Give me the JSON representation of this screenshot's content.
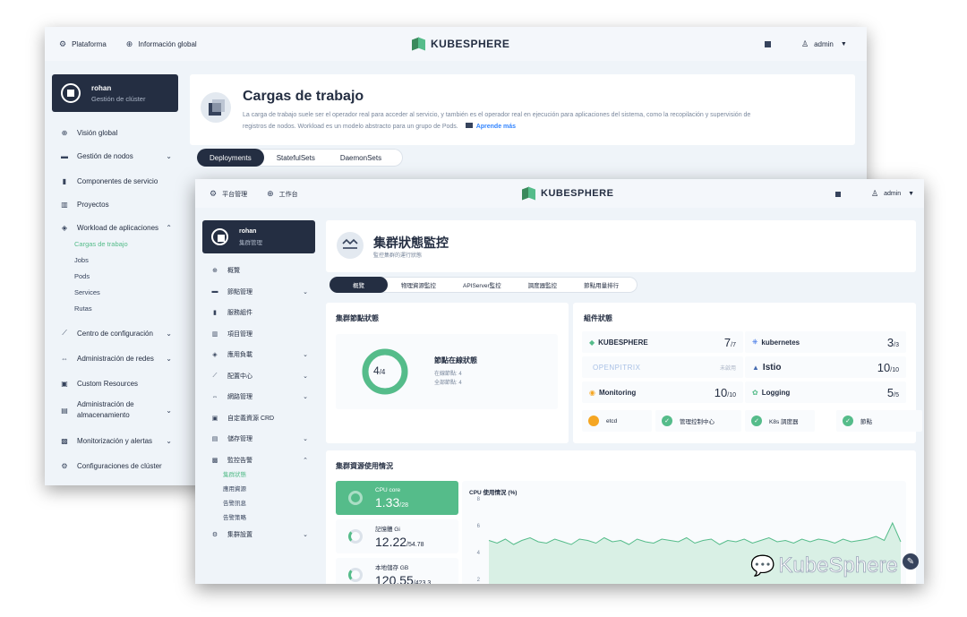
{
  "back": {
    "topbar": {
      "platform": "Plataforma",
      "global_info": "Información global",
      "logo": "KUBESPHERE",
      "user": "admin"
    },
    "cluster": {
      "name": "rohan",
      "role": "Gestión de clúster"
    },
    "nav": [
      {
        "label": "Visión global",
        "icon": "globe-icon",
        "chevron": false
      },
      {
        "label": "Gestión de nodos",
        "icon": "server-icon",
        "chevron": true
      },
      {
        "label": "Componentes de servicio",
        "icon": "components-icon",
        "chevron": false
      },
      {
        "label": "Proyectos",
        "icon": "projects-icon",
        "chevron": false
      },
      {
        "label": "Workload de aplicaciones",
        "icon": "layers-icon",
        "chevron": true,
        "expanded": true
      }
    ],
    "nav_sub": [
      "Cargas de trabajo",
      "Jobs",
      "Pods",
      "Services",
      "Rutas"
    ],
    "nav_more": [
      {
        "label": "Centro de configuración",
        "icon": "wrench-icon",
        "chevron": true
      },
      {
        "label": "Administración de redes",
        "icon": "network-icon",
        "chevron": true
      },
      {
        "label": "Custom Resources",
        "icon": "crd-icon",
        "chevron": false
      },
      {
        "label": "Administración de almacenamiento",
        "icon": "storage-icon",
        "chevron": true
      },
      {
        "label": "Monitorización y alertas",
        "icon": "monitor-icon",
        "chevron": true
      },
      {
        "label": "Configuraciones de clúster",
        "icon": "gear-icon",
        "chevron": false
      }
    ],
    "banner": {
      "title": "Cargas de trabajo",
      "desc1": "La carga de trabajo suele ser el operador real para acceder al servicio, y también es el operador real en ejecución para aplicaciones del sistema, como la recopilación y supervisión de",
      "desc2": "registros de nodos. Workload es un modelo abstracto para un grupo de Pods.",
      "learn_more": "Aprende más"
    },
    "tabs": [
      "Deployments",
      "StatefulSets",
      "DaemonSets"
    ]
  },
  "front": {
    "topbar": {
      "platform": "平台管理",
      "workbench": "工作台",
      "logo": "KUBESPHERE",
      "user": "admin"
    },
    "cluster": {
      "name": "rohan",
      "role": "集群管理"
    },
    "nav": [
      "概覽",
      "節點管理",
      "服務組件",
      "項目管理",
      "應用負載",
      "配置中心",
      "網路管理",
      "自定義資源 CRD",
      "儲存管理",
      "監控告警"
    ],
    "nav_chev": [
      false,
      true,
      false,
      false,
      true,
      true,
      true,
      false,
      true,
      true
    ],
    "nav_sub": [
      "集群狀態",
      "應用資源",
      "告警訊息",
      "告警策略"
    ],
    "nav_last": "集群設置",
    "header": {
      "title": "集群狀態監控",
      "subtitle": "監控集群的運行狀態"
    },
    "tabs": [
      "概覽",
      "物理資源監控",
      "APIServer監控",
      "調度器監控",
      "節點用量排行"
    ],
    "node_status": {
      "title": "集群節點狀態",
      "ratio_main": "4",
      "ratio_total": "/4",
      "online_title": "節點在線狀態",
      "online_label": "在線節點: 4",
      "total_label": "全部節點: 4",
      "online": 4,
      "total": 4
    },
    "components": {
      "title": "組件狀態",
      "rows": [
        {
          "name": "KUBESPHERE",
          "value": "7",
          "total": "/7"
        },
        {
          "name": "kubernetes",
          "value": "3",
          "total": "/3"
        },
        {
          "name": "OPENPITRIX",
          "value": "未啟用",
          "total": ""
        },
        {
          "name": "Istio",
          "value": "10",
          "total": "/10"
        },
        {
          "name": "Monitoring",
          "value": "10",
          "total": "/10"
        },
        {
          "name": "Logging",
          "value": "5",
          "total": "/5"
        }
      ],
      "checks": [
        "etcd",
        "管理控制中心",
        "K8s 調度器",
        "節點"
      ]
    },
    "usage": {
      "title": "集群資源使用情況",
      "metrics": [
        {
          "label": "CPU core",
          "value": "1.33",
          "total": "/28"
        },
        {
          "label": "記憶體 Gi",
          "value": "12.22",
          "total": "/54.78"
        },
        {
          "label": "本地儲存 GB",
          "value": "120.55",
          "total": "/423.3"
        }
      ],
      "chart": {
        "title": "CPU 使用情況 (%)",
        "ticks": [
          "8",
          "6",
          "4",
          "2"
        ]
      }
    },
    "watermark": "KubeSphere"
  },
  "chart_data": {
    "type": "area",
    "title": "CPU 使用情況 (%)",
    "ylim": [
      2,
      8
    ],
    "y_ticks": [
      8,
      6,
      4,
      2
    ],
    "series": [
      {
        "values": [
          4.9,
          4.7,
          5.0,
          4.6,
          4.9,
          5.1,
          4.8,
          4.7,
          5.0,
          4.8,
          4.6,
          5.0,
          4.9,
          4.7,
          5.1,
          4.8,
          4.9,
          4.6,
          5.0,
          4.8,
          4.7,
          5.0,
          4.9,
          4.8,
          5.1,
          4.7,
          4.9,
          5.0,
          4.6,
          4.9,
          4.8,
          5.0,
          4.7,
          4.9,
          5.1,
          4.8,
          4.9,
          4.7,
          5.0,
          4.8,
          5.0,
          4.9,
          4.7,
          5.0,
          4.8,
          4.9,
          5.0,
          5.2,
          4.9,
          6.2,
          4.8
        ]
      }
    ]
  }
}
